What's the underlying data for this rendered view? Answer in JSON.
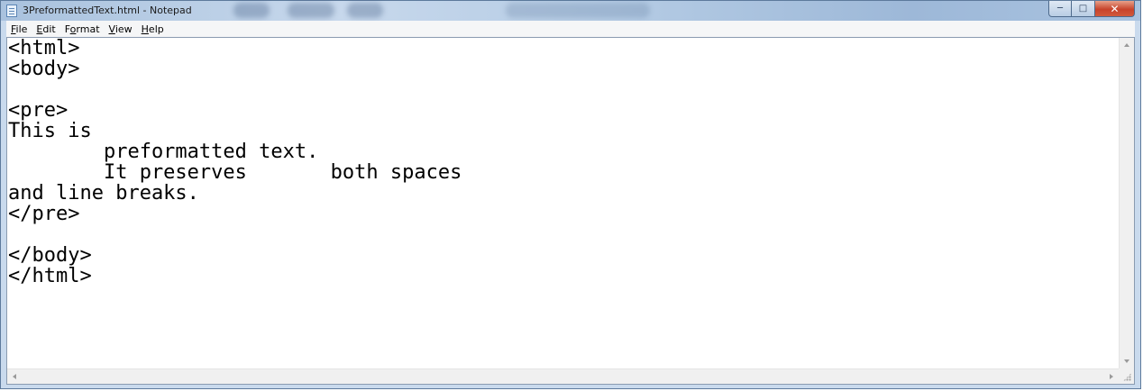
{
  "window": {
    "title": "3PreformattedText.html - Notepad",
    "icon": "notepad-icon",
    "controls": {
      "minimize": "minimize-icon",
      "maximize": "maximize-icon",
      "close": "close-icon"
    }
  },
  "menu": {
    "items": [
      {
        "label": "File",
        "mnemonic": "F",
        "rest": "ile"
      },
      {
        "label": "Edit",
        "mnemonic": "E",
        "rest": "dit"
      },
      {
        "label": "Format",
        "mnemonic": "o",
        "pre": "F",
        "rest": "rmat"
      },
      {
        "label": "View",
        "mnemonic": "V",
        "rest": "iew"
      },
      {
        "label": "Help",
        "mnemonic": "H",
        "rest": "elp"
      }
    ]
  },
  "editor": {
    "lines": [
      "<html>",
      "<body>",
      "",
      "<pre>",
      "This is",
      "        preformatted text.",
      "        It preserves       both spaces",
      "and line breaks.",
      "</pre>",
      "",
      "</body>",
      "</html>"
    ]
  },
  "colors": {
    "titlebar": "#b4cbe4",
    "close_button": "#c7432b",
    "editor_background": "#ffffff"
  }
}
